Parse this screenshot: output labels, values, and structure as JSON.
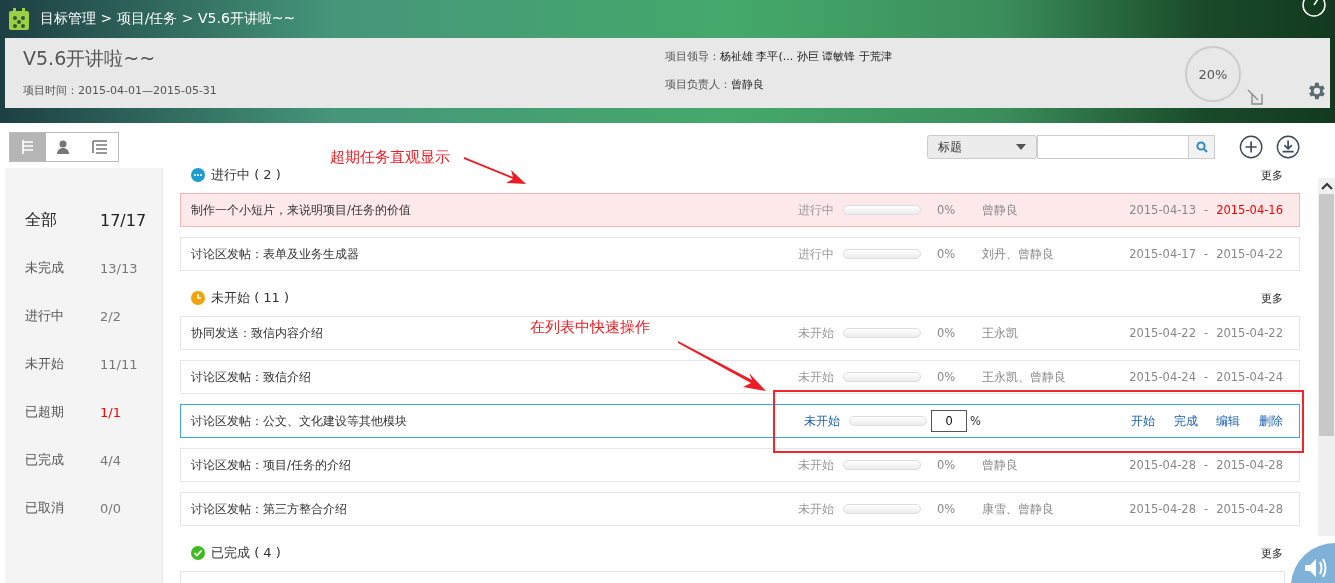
{
  "header": {
    "breadcrumb": "目标管理 > 项目/任务 > V5.6开讲啦~~"
  },
  "project": {
    "title": "V5.6开讲啦~~",
    "time_label": "项目时间：",
    "time": "2015-04-01—2015-05-31",
    "leader_label": "项目领导：",
    "leaders": "杨祉雄 李平(... 孙巨 谭敏锋 于荒津",
    "owner_label": "项目负责人：",
    "owner": "曾静良",
    "progress": "20%"
  },
  "view_tabs": [
    {
      "kind": "tree",
      "selected": true
    },
    {
      "kind": "person",
      "selected": false
    },
    {
      "kind": "list",
      "selected": false
    }
  ],
  "filters": [
    {
      "label": "全部",
      "count": "17/17",
      "selected": true,
      "alert": false
    },
    {
      "label": "未完成",
      "count": "13/13",
      "selected": false,
      "alert": false
    },
    {
      "label": "进行中",
      "count": "2/2",
      "selected": false,
      "alert": false
    },
    {
      "label": "未开始",
      "count": "11/11",
      "selected": false,
      "alert": false
    },
    {
      "label": "已超期",
      "count": "1/1",
      "selected": false,
      "alert": true
    },
    {
      "label": "已完成",
      "count": "4/4",
      "selected": false,
      "alert": false
    },
    {
      "label": "已取消",
      "count": "0/0",
      "selected": false,
      "alert": false
    }
  ],
  "toolbar": {
    "field_select": "标题"
  },
  "annotations": [
    {
      "text": "超期任务直观显示"
    },
    {
      "text": "在列表中快速操作"
    }
  ],
  "groups": [
    {
      "kind": "ongoing",
      "title": "进行中",
      "count": "( 2 )",
      "more": "更多",
      "tasks": [
        {
          "kind": "row",
          "title": "制作一个小短片，来说明项目/任务的价值",
          "status": "进行中",
          "level": 0,
          "percent": "0%",
          "people": "曾静良",
          "start": "2015-04-13",
          "sep": "-",
          "end": "2015-04-16",
          "overdue": true
        },
        {
          "kind": "row",
          "title": "讨论区发帖：表单及业务生成器",
          "status": "进行中",
          "level": 0,
          "percent": "0%",
          "people": "刘丹、曾静良",
          "start": "2015-04-17",
          "sep": "-",
          "end": "2015-04-22",
          "overdue": false
        }
      ]
    },
    {
      "kind": "pending",
      "title": "未开始",
      "count": "( 11 )",
      "more": "更多",
      "tasks": [
        {
          "kind": "row",
          "title": "协同发送：致信内容介绍",
          "status": "未开始",
          "level": 0,
          "percent": "0%",
          "people": "王永凯",
          "start": "2015-04-22",
          "sep": "-",
          "end": "2015-04-22",
          "overdue": false
        },
        {
          "kind": "row",
          "title": "讨论区发帖：致信介绍",
          "status": "未开始",
          "level": 0,
          "percent": "0%",
          "people": "王永凯、曾静良",
          "start": "2015-04-24",
          "sep": "-",
          "end": "2015-04-24",
          "overdue": false
        },
        {
          "kind": "editing",
          "title": "讨论区发帖：公文、文化建设等其他模块",
          "status": "未开始",
          "level": 0,
          "value": "0",
          "unit": "%",
          "actions": [
            "开始",
            "完成",
            "编辑",
            "删除"
          ]
        },
        {
          "kind": "row",
          "title": "讨论区发帖：项目/任务的介绍",
          "status": "未开始",
          "level": 0,
          "percent": "0%",
          "people": "曾静良",
          "start": "2015-04-28",
          "sep": "-",
          "end": "2015-04-28",
          "overdue": false
        },
        {
          "kind": "row",
          "title": "讨论区发帖：第三方整合介绍",
          "status": "未开始",
          "level": 0,
          "percent": "0%",
          "people": "康雪、曾静良",
          "start": "2015-04-28",
          "sep": "-",
          "end": "2015-04-28",
          "overdue": false
        }
      ]
    },
    {
      "kind": "done",
      "title": "已完成",
      "count": "( 4 )",
      "more": "更多"
    }
  ]
}
